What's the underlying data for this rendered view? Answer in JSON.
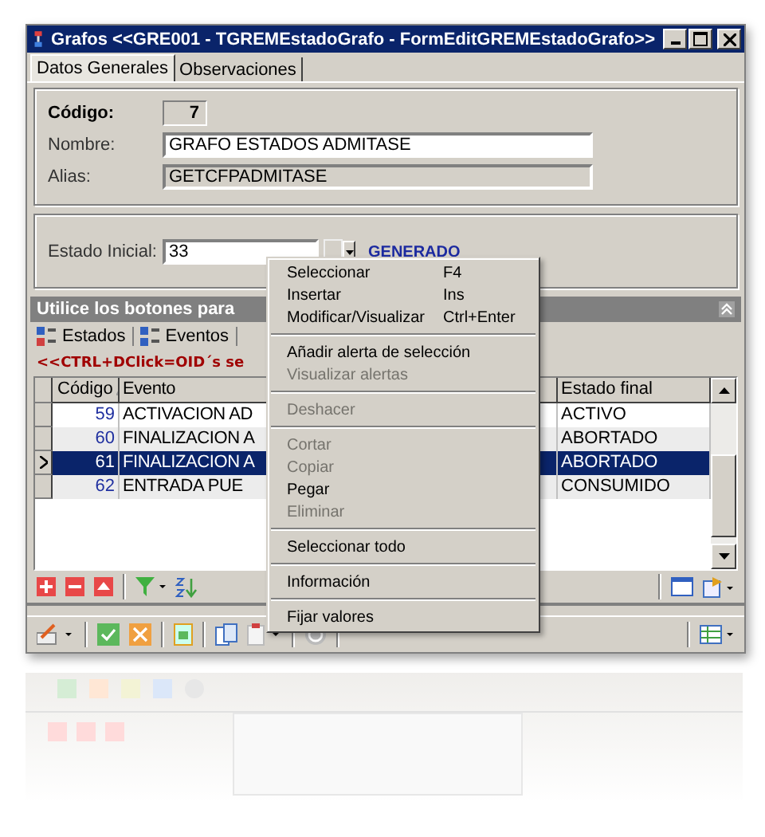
{
  "window": {
    "title": "Grafos  <<GRE001 - TGREMEstadoGrafo - FormEditGREMEstadoGrafo>>"
  },
  "tabs": [
    {
      "label": "Datos Generales",
      "selected": true
    },
    {
      "label": "Observaciones",
      "selected": false
    }
  ],
  "header_fields": [
    {
      "kind": "code",
      "label": "Código:",
      "value": "7"
    },
    {
      "kind": "edit",
      "label": "Nombre:",
      "value": "GRAFO ESTADOS ADMITASE"
    },
    {
      "kind": "readonly",
      "label": "Alias:",
      "value": "GETCFPADMITASE"
    }
  ],
  "estado_inicial": {
    "label": "Estado Inicial:",
    "value": "33",
    "description": "GENERADO"
  },
  "detail": {
    "caption": "Utilice los botones para",
    "tabs": [
      {
        "label": "Estados"
      },
      {
        "label": "Eventos"
      }
    ],
    "hint": "<<CTRL+DClick=OID´s se",
    "columns": [
      "Código",
      "Evento",
      "Estado final"
    ],
    "rows": [
      {
        "codigo": "59",
        "evento": "ACTIVACION AD",
        "estado_final": "ACTIVO",
        "selected": false
      },
      {
        "codigo": "60",
        "evento": "FINALIZACION A",
        "estado_final": "ABORTADO",
        "selected": false
      },
      {
        "codigo": "61",
        "evento": "FINALIZACION A",
        "estado_final": "ABORTADO",
        "selected": true
      },
      {
        "codigo": "62",
        "evento": "ENTRADA PUE",
        "estado_final": "CONSUMIDO",
        "selected": false
      }
    ]
  },
  "context_menu": [
    {
      "kind": "item",
      "label": "Seleccionar",
      "shortcut": "F4",
      "disabled": false
    },
    {
      "kind": "item",
      "label": "Insertar",
      "shortcut": "Ins",
      "disabled": false
    },
    {
      "kind": "item",
      "label": "Modificar/Visualizar",
      "shortcut": "Ctrl+Enter",
      "disabled": false
    },
    {
      "kind": "separator"
    },
    {
      "kind": "item",
      "label": "Añadir alerta de selección",
      "disabled": false
    },
    {
      "kind": "item",
      "label": "Visualizar alertas",
      "disabled": true
    },
    {
      "kind": "separator"
    },
    {
      "kind": "item",
      "label": "Deshacer",
      "disabled": true
    },
    {
      "kind": "separator"
    },
    {
      "kind": "item",
      "label": "Cortar",
      "disabled": true
    },
    {
      "kind": "item",
      "label": "Copiar",
      "disabled": true
    },
    {
      "kind": "item",
      "label": "Pegar",
      "disabled": false
    },
    {
      "kind": "item",
      "label": "Eliminar",
      "disabled": true
    },
    {
      "kind": "separator"
    },
    {
      "kind": "item",
      "label": "Seleccionar todo",
      "disabled": false
    },
    {
      "kind": "separator"
    },
    {
      "kind": "item",
      "label": "Información",
      "disabled": false
    },
    {
      "kind": "separator"
    },
    {
      "kind": "item",
      "label": "Fijar valores",
      "disabled": false
    }
  ]
}
